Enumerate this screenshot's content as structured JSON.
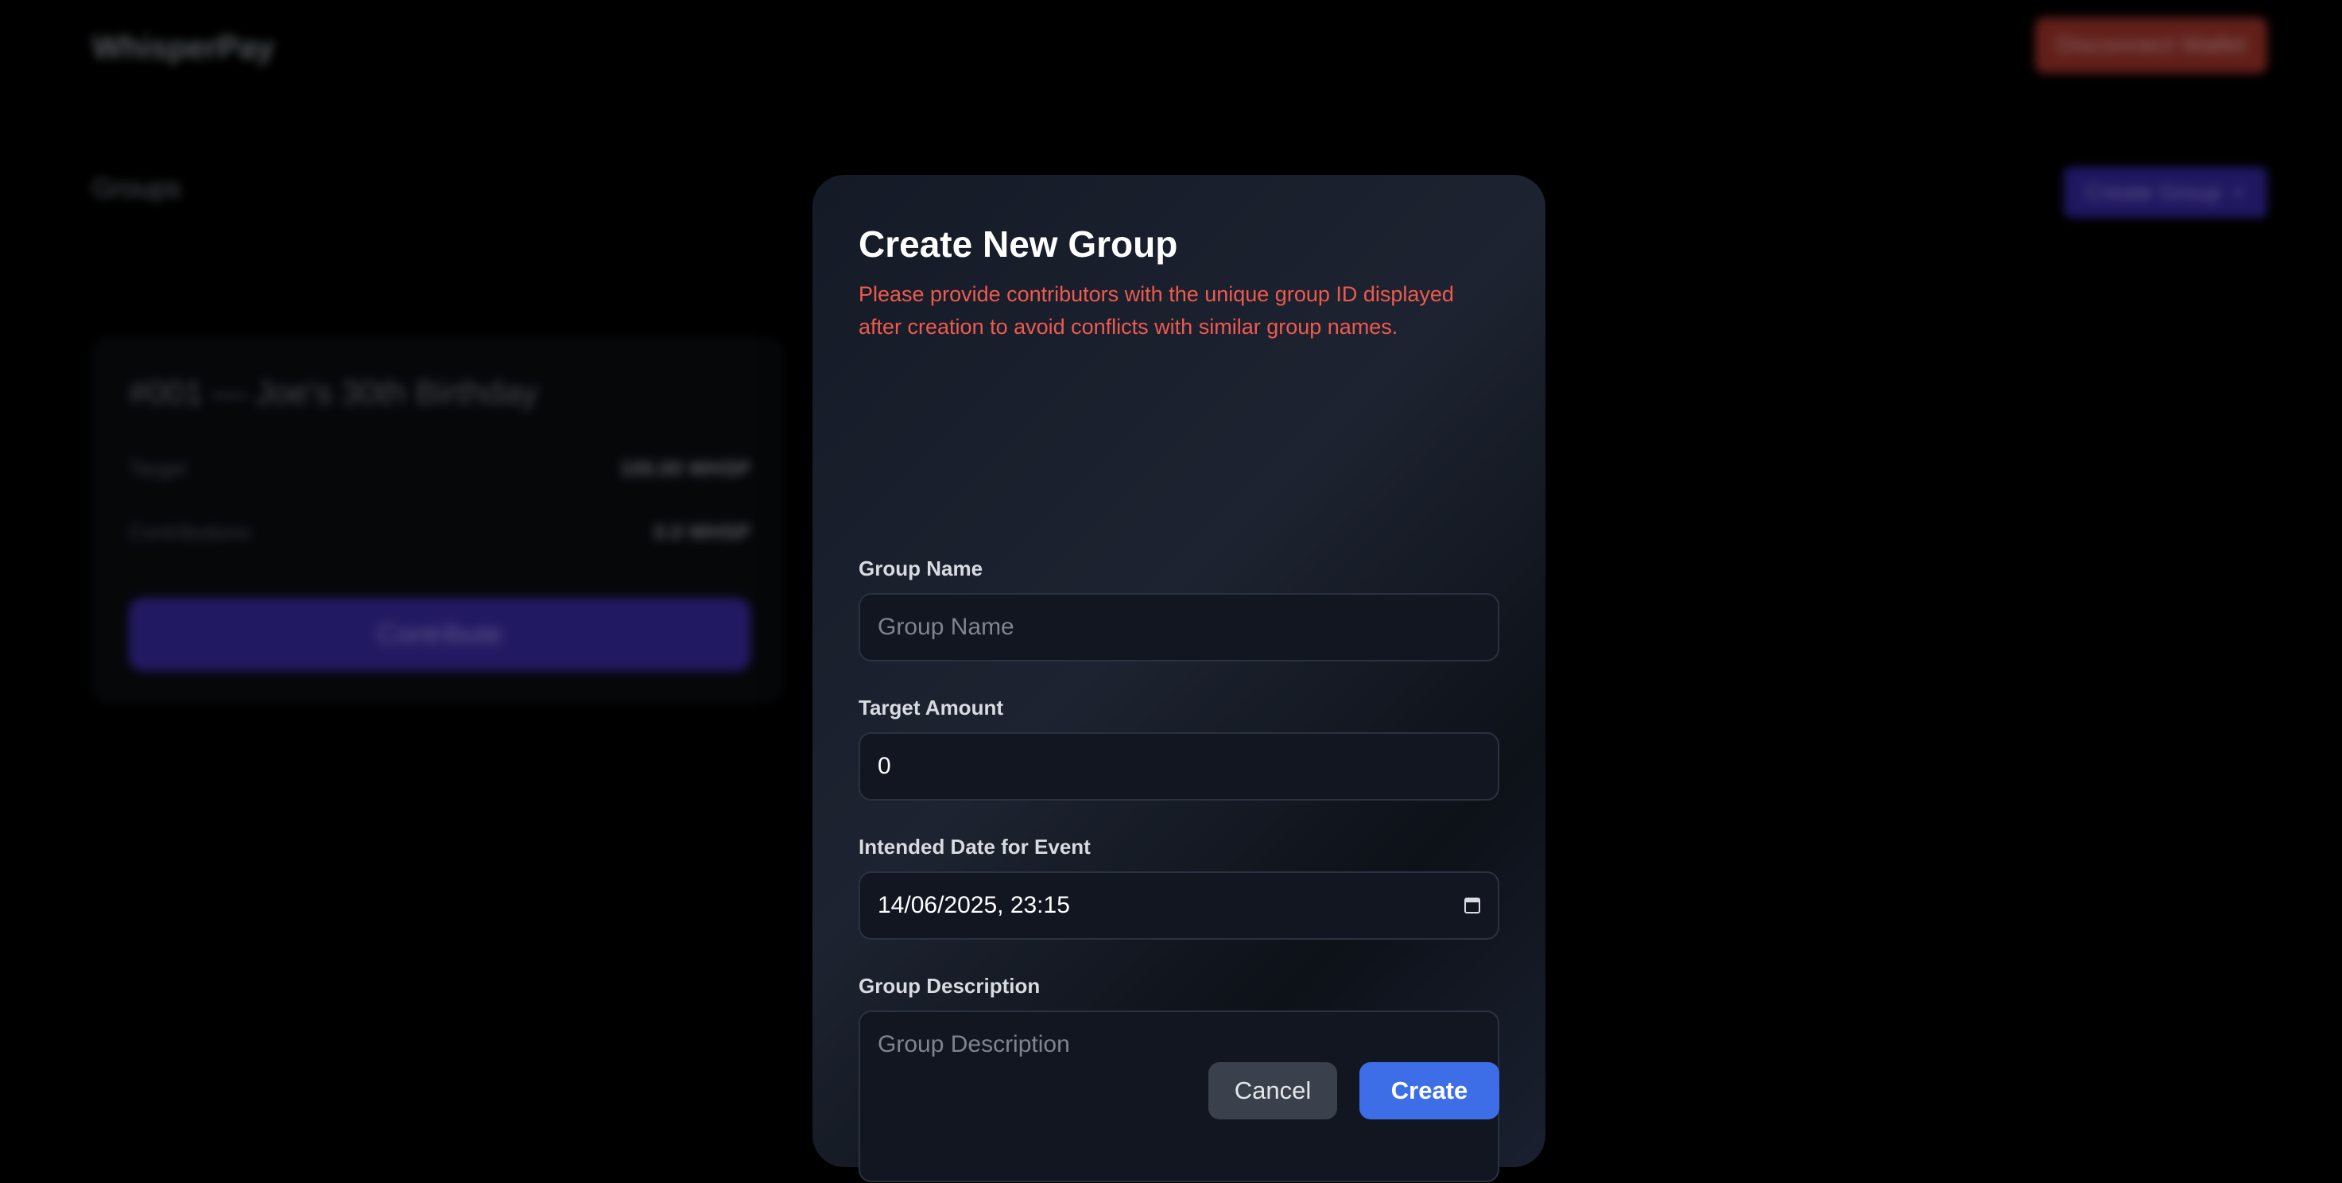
{
  "app": {
    "name": "WhisperPay",
    "disconnect_label": "Disconnect Wallet"
  },
  "groups_section": {
    "heading": "Groups",
    "create_button_label": "Create Group",
    "create_button_icon": "plus-icon"
  },
  "group_card": {
    "title": "#001 — Joe's 30th Birthday",
    "target_label": "Target",
    "target_value": "100.00 WHSP",
    "contributions_label": "Contributions",
    "contributions_value": "0.0 WHSP",
    "contribute_label": "Contribute"
  },
  "modal": {
    "title": "Create New Group",
    "note": "Please provide contributors with the unique group ID displayed after creation to avoid conflicts with similar group names.",
    "fields": {
      "group_name": {
        "label": "Group Name",
        "placeholder": "Group Name",
        "value": ""
      },
      "target_amount": {
        "label": "Target Amount",
        "value": "0"
      },
      "event_date": {
        "label": "Intended Date for Event",
        "value": "14/06/2025, 23:15",
        "icon": "calendar-icon"
      },
      "description": {
        "label": "Group Description",
        "placeholder": "Group Description",
        "value": ""
      }
    },
    "cancel_label": "Cancel",
    "create_label": "Create"
  },
  "colors": {
    "backdrop": "#000000",
    "note_text": "#ef5a4f",
    "primary_button": "#3d6ee8",
    "secondary_button": "#3a404c",
    "disconnect_button": "#b3382f",
    "accent_purple": "#3f2fb4"
  }
}
